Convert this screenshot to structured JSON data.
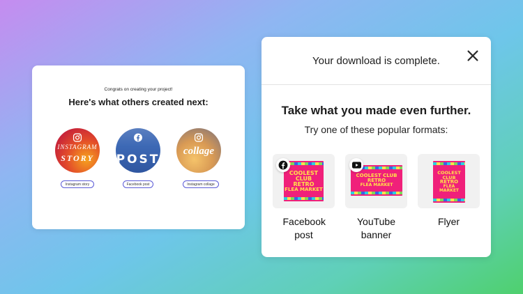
{
  "left_card": {
    "congrats": "Congrats on creating your project!",
    "heading": "Here's what others created next:",
    "items": [
      {
        "label": "Instagram story",
        "art_line1": "INSTAGRAM",
        "art_line2": "STORY",
        "icon": "instagram-icon"
      },
      {
        "label": "Facebook post",
        "art_word": "POST",
        "icon": "facebook-icon"
      },
      {
        "label": "Instagram collage",
        "art_word": "collage",
        "icon": "instagram-icon"
      }
    ]
  },
  "right_card": {
    "title": "Your download is complete.",
    "close_icon": "close-icon",
    "heading": "Take what you made even further.",
    "subheading": "Try one of these popular formats:",
    "formats": [
      {
        "label": "Facebook post",
        "icon": "facebook-icon"
      },
      {
        "label": "YouTube banner",
        "icon": "youtube-icon"
      },
      {
        "label": "Flyer"
      }
    ],
    "poster_text": [
      "COOLEST CLUB",
      "RETRO",
      "FLEA MARKET"
    ]
  },
  "colors": {
    "accent_pill_border": "#5a5ad6",
    "poster_bg": "#f0207a",
    "poster_text": "#ffe14a"
  }
}
